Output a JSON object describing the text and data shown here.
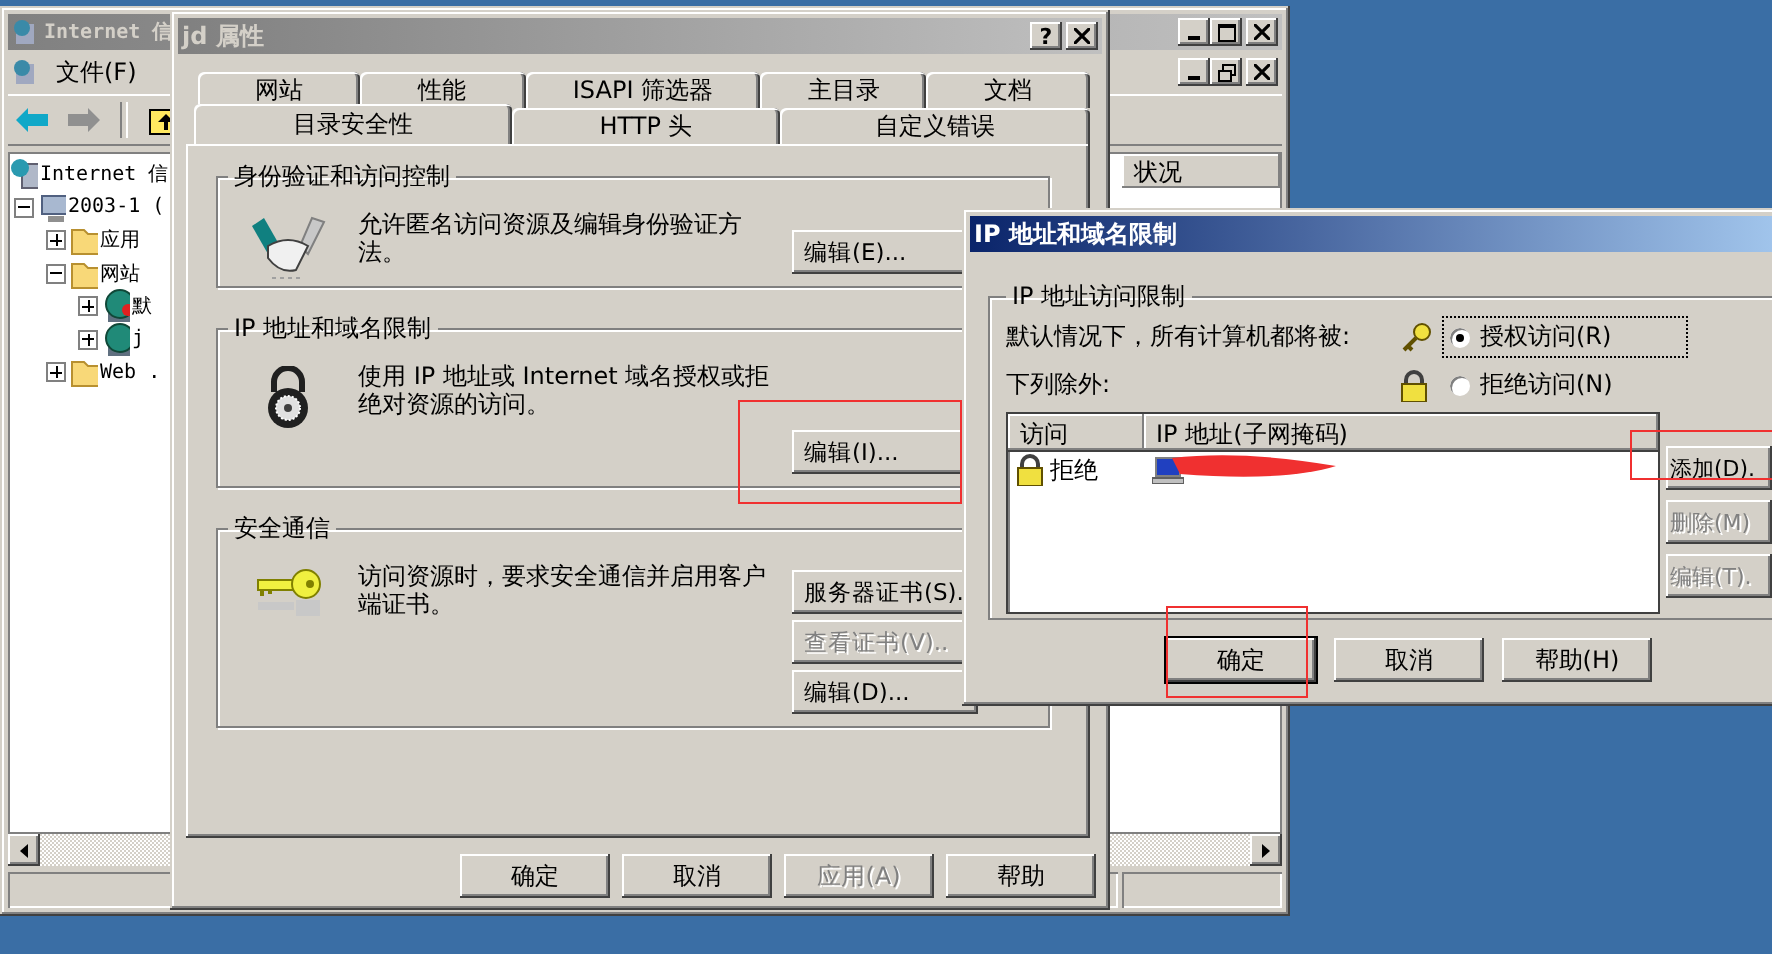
{
  "mmc": {
    "title": "Internet 信",
    "menu": [
      "文件(F)"
    ],
    "tree": [
      {
        "label": "Internet 信",
        "kind": "root",
        "children": [
          {
            "label": "2003-1 (",
            "kind": "server",
            "expanded": true,
            "children": [
              {
                "label": "应用",
                "kind": "folder",
                "expanded": false
              },
              {
                "label": "网站",
                "kind": "folder",
                "expanded": true,
                "children": [
                  {
                    "label": "默",
                    "kind": "site-stopped",
                    "expanded": false
                  },
                  {
                    "label": "j",
                    "kind": "site",
                    "expanded": false
                  }
                ]
              },
              {
                "label": "Web .",
                "kind": "folder",
                "expanded": false
              }
            ]
          }
        ]
      }
    ],
    "columns": [
      "状况"
    ]
  },
  "props": {
    "title": "jd 属性",
    "help": "?",
    "tab_rows": [
      [
        {
          "label": "网站",
          "selected": false
        },
        {
          "label": "性能",
          "selected": false
        },
        {
          "label": "ISAPI 筛选器",
          "selected": false
        },
        {
          "label": "主目录",
          "selected": false
        },
        {
          "label": "文档",
          "selected": false
        }
      ],
      [
        {
          "label": "目录安全性",
          "selected": true
        },
        {
          "label": "HTTP 头",
          "selected": false
        },
        {
          "label": "自定义错误",
          "selected": false
        }
      ]
    ],
    "groups": [
      {
        "title": "身份验证和访问控制",
        "description": "允许匿名访问资源及编辑身份验证方法。",
        "buttons": [
          {
            "label": "编辑(E)...",
            "disabled": false
          }
        ]
      },
      {
        "title": "IP 地址和域名限制",
        "description": "使用 IP 地址或 Internet 域名授权或拒绝对资源的访问。",
        "buttons": [
          {
            "label": "编辑(I)...",
            "disabled": false
          }
        ]
      },
      {
        "title": "安全通信",
        "description": "访问资源时，要求安全通信并启用客户端证书。",
        "buttons": [
          {
            "label": "服务器证书(S).",
            "disabled": false
          },
          {
            "label": "查看证书(V)..",
            "disabled": true
          },
          {
            "label": "编辑(D)...",
            "disabled": false
          }
        ]
      }
    ],
    "buttons": [
      {
        "label": "确定",
        "disabled": false
      },
      {
        "label": "取消",
        "disabled": false
      },
      {
        "label": "应用(A)",
        "disabled": true
      },
      {
        "label": "帮助",
        "disabled": false
      }
    ]
  },
  "ip": {
    "title": "IP 地址和域名限制",
    "group_title": "IP 地址访问限制",
    "labels": [
      "默认情况下，所有计算机都将被:",
      "下列除外:"
    ],
    "options": [
      {
        "label": "授权访问(R)",
        "selected": true
      },
      {
        "label": "拒绝访问(N)",
        "selected": false
      }
    ],
    "columns": [
      "访问",
      "IP 地址(子网掩码)"
    ],
    "rows": [
      {
        "access": "拒绝"
      }
    ],
    "side_buttons": [
      {
        "label": "添加(D).",
        "disabled": false
      },
      {
        "label": "删除(M)",
        "disabled": true
      },
      {
        "label": "编辑(T).",
        "disabled": true
      }
    ],
    "buttons": [
      {
        "label": "确定",
        "default": true
      },
      {
        "label": "取消",
        "default": false
      },
      {
        "label": "帮助(H)",
        "default": false
      }
    ]
  }
}
